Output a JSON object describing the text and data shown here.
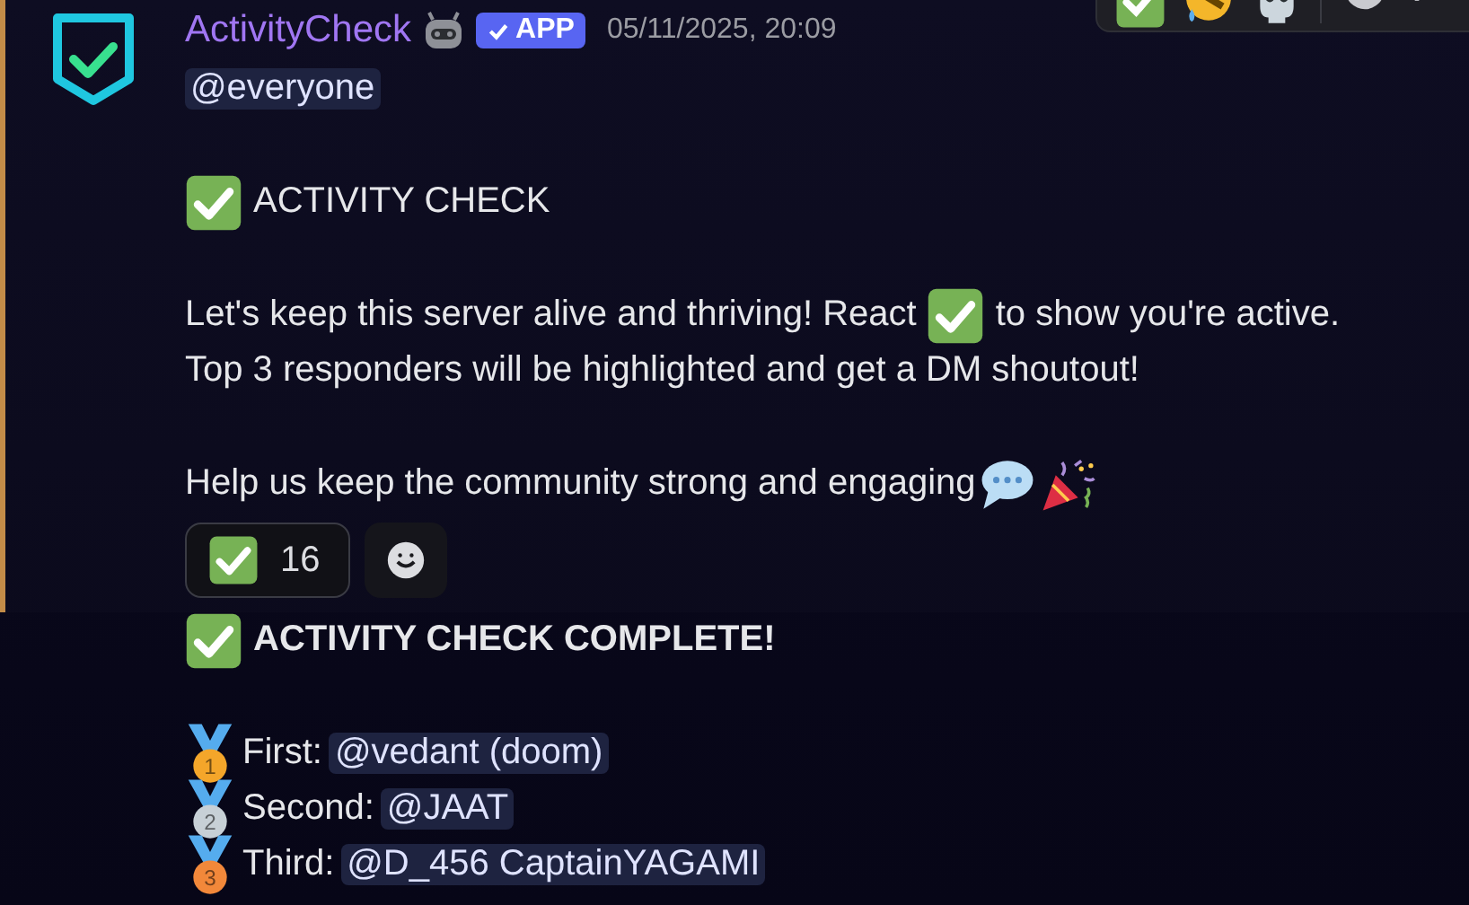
{
  "message": {
    "author": "ActivityCheck",
    "badge": "APP",
    "timestamp": "05/11/2025, 20:09",
    "mentioned": true,
    "mention": "@everyone",
    "title": "ACTIVITY CHECK",
    "paragraph": {
      "before_emoji": "Let's keep this server alive and thriving! React",
      "after_emoji": "to show you're active.",
      "second_line": "Top 3 responders will be highlighted and get a DM shoutout!"
    },
    "closing": "Help us keep the community strong and engaging",
    "reactions": [
      {
        "count": "16",
        "selected": false
      }
    ]
  },
  "followup": {
    "title": "ACTIVITY CHECK COMPLETE!",
    "results": [
      {
        "rank": "1",
        "color": "#f4a62a",
        "label": "First:",
        "mention": "@vedant (doom)"
      },
      {
        "rank": "2",
        "color": "#c7d0d6",
        "label": "Second:",
        "mention": "@JAAT"
      },
      {
        "rank": "3",
        "color": "#f2883a",
        "label": "Third:",
        "mention": "@D_456 CaptainYAGAMI"
      }
    ]
  }
}
